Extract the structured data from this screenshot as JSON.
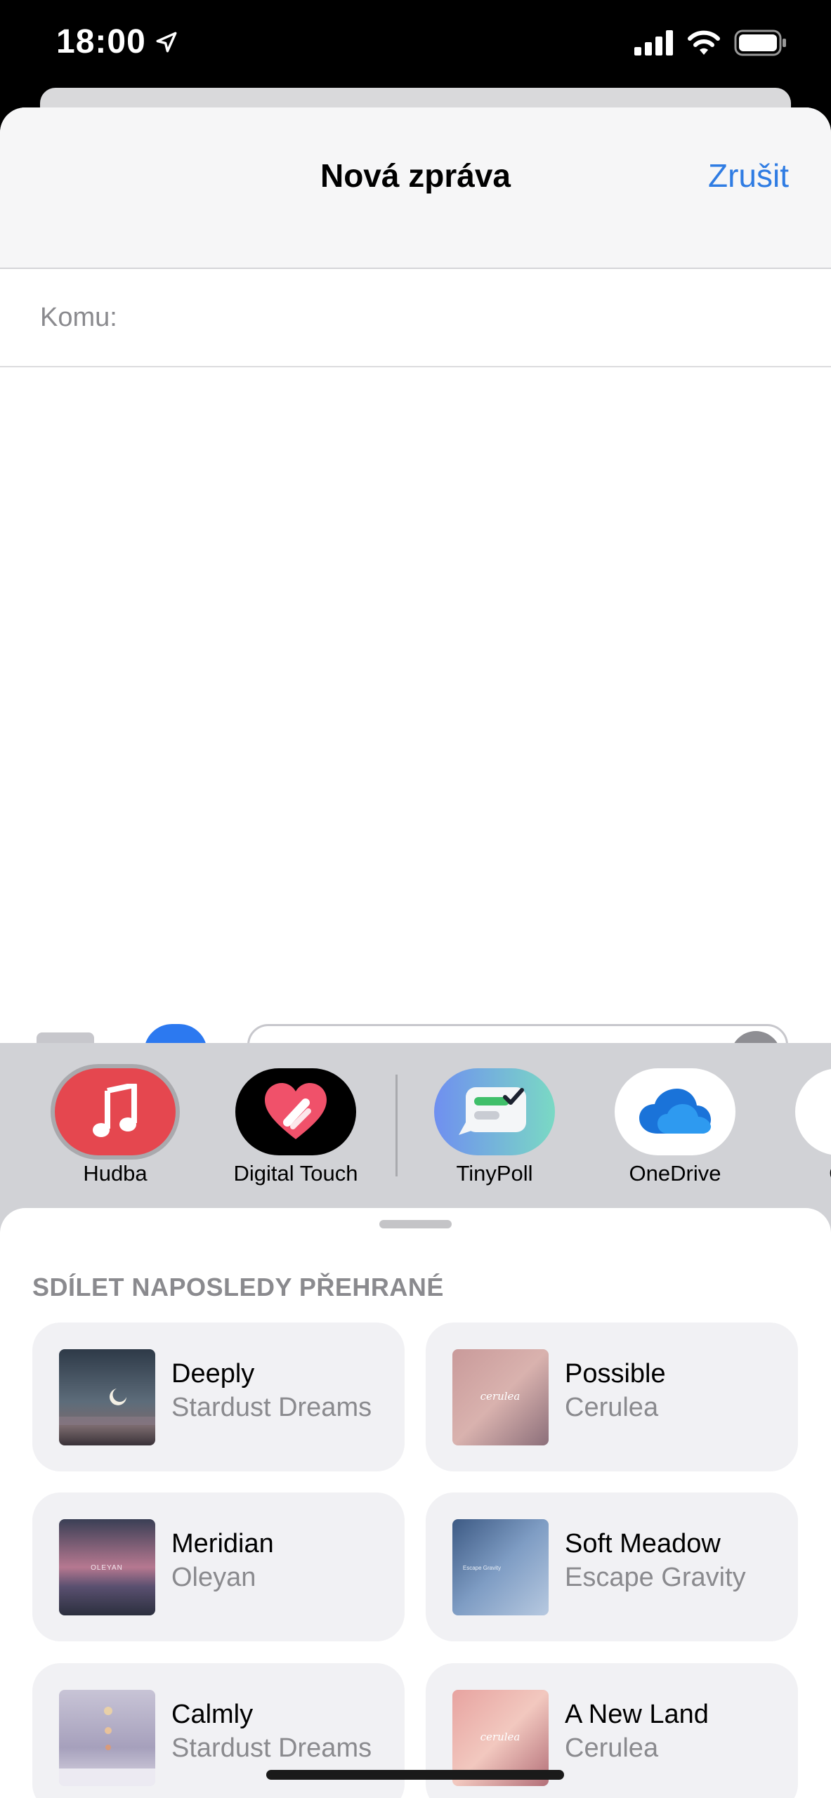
{
  "status_bar": {
    "time": "18:00"
  },
  "compose": {
    "title": "Nová zpráva",
    "cancel_label": "Zrušit",
    "to_label": "Komu:"
  },
  "apps": [
    {
      "label": "Hudba",
      "icon": "music-note-icon",
      "selected": true
    },
    {
      "label": "Digital Touch",
      "icon": "digital-touch-heart-icon"
    },
    {
      "label": "TinyPoll",
      "icon": "tinypoll-icon"
    },
    {
      "label": "OneDrive",
      "icon": "onedrive-cloud-icon"
    },
    {
      "label": "Goog",
      "icon": "google-icon"
    }
  ],
  "music": {
    "section_title": "SDÍLET NAPOSLEDY PŘEHRANÉ",
    "tracks": [
      {
        "title": "Deeply",
        "artist": "Stardust Dreams"
      },
      {
        "title": "Possible",
        "artist": "Cerulea",
        "art_text": "cerulea"
      },
      {
        "title": "Meridian",
        "artist": "Oleyan",
        "art_text": "OLEYAN"
      },
      {
        "title": "Soft Meadow",
        "artist": "Escape Gravity",
        "art_text": "Escape Gravity"
      },
      {
        "title": "Calmly",
        "artist": "Stardust Dreams"
      },
      {
        "title": "A New Land",
        "artist": "Cerulea",
        "art_text": "cerulea"
      }
    ]
  },
  "colors": {
    "accent": "#2f7ce3",
    "drawer_bg": "#d1d2d6",
    "card_bg": "#f1f1f4"
  }
}
